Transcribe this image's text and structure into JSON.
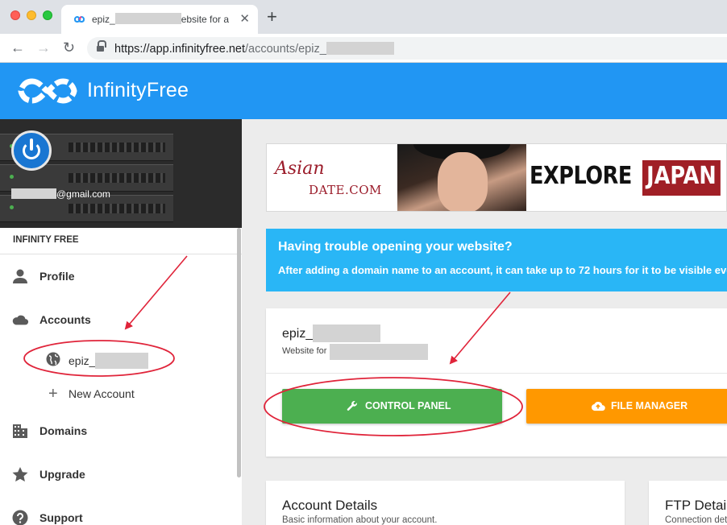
{
  "browser": {
    "tab_title_prefix": "epiz_",
    "tab_title_suffix": "ebsite for a",
    "close_glyph": "✕",
    "new_tab_glyph": "+",
    "back_glyph": "←",
    "forward_glyph": "→",
    "reload_glyph": "↻",
    "url_host": "https://app.infinityfree.net",
    "url_path": "/accounts/epiz_"
  },
  "header": {
    "brand": "InfinityFree",
    "color": "#2196f3"
  },
  "user": {
    "email_suffix": "@gmail.com"
  },
  "sidebar": {
    "section": "INFINITY FREE",
    "items": {
      "profile": "Profile",
      "accounts": "Accounts",
      "account_entry": "epiz_",
      "new_account": "New Account",
      "domains": "Domains",
      "upgrade": "Upgrade",
      "support": "Support"
    },
    "plus_glyph": "+"
  },
  "ad": {
    "logo_script": "Asian",
    "logo_date": "DATE.COM",
    "headline_1": "EXPLORE",
    "headline_2": "JAPAN"
  },
  "notice": {
    "title": "Having trouble opening your website?",
    "body": "After adding a domain name to an account, it can take up to 72 hours for it to be visible everywhere.",
    "color": "#29b6f6"
  },
  "account": {
    "name": "epiz_",
    "subtitle": "Website for",
    "control_panel": "CONTROL PANEL",
    "file_manager": "FILE MANAGER",
    "control_panel_color": "#4caf50",
    "file_manager_color": "#ff9800"
  },
  "details": {
    "account_title": "Account Details",
    "account_sub": "Basic information about your account.",
    "ftp_title": "FTP Details",
    "ftp_sub": "Connection details"
  },
  "annotation_color": "#e0243a"
}
